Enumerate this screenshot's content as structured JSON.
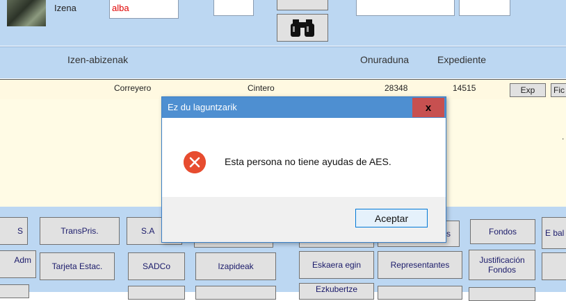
{
  "top": {
    "name_label": "Izena",
    "name_value": "alba"
  },
  "columns": {
    "name": "Izen-abizenak",
    "beneficiary": "Onuraduna",
    "file": "Expediente"
  },
  "row": {
    "surname1": "Correyero",
    "surname2": "Cintero",
    "beneficiary": "28348",
    "file": "14515",
    "exp_button": "Exp",
    "fic_button": "Fic"
  },
  "body": {
    "right_mark": "."
  },
  "buttons": {
    "row1": [
      "S",
      "TransPris.",
      "S.A",
      "",
      "",
      "s",
      "Fondos",
      "E bal"
    ],
    "row2": [
      "Adm",
      "Tarjeta Estac.",
      "SADCo",
      "Izapideak",
      "Eskaera egin",
      "Representantes",
      "Justificación Fondos",
      ""
    ],
    "row3_partial": "Ezkubertze"
  },
  "dialog": {
    "title": "Ez du laguntzarik",
    "close_label": "x",
    "message": "Esta persona no tiene ayudas de AES.",
    "ok_label": "Aceptar",
    "icon": "error-icon"
  },
  "colors": {
    "header_blue": "#bcd7f2",
    "row_yellow": "#fff9e1",
    "title_blue": "#4e8fd1",
    "close_red": "#c75050",
    "error_red": "#e74c2f"
  }
}
